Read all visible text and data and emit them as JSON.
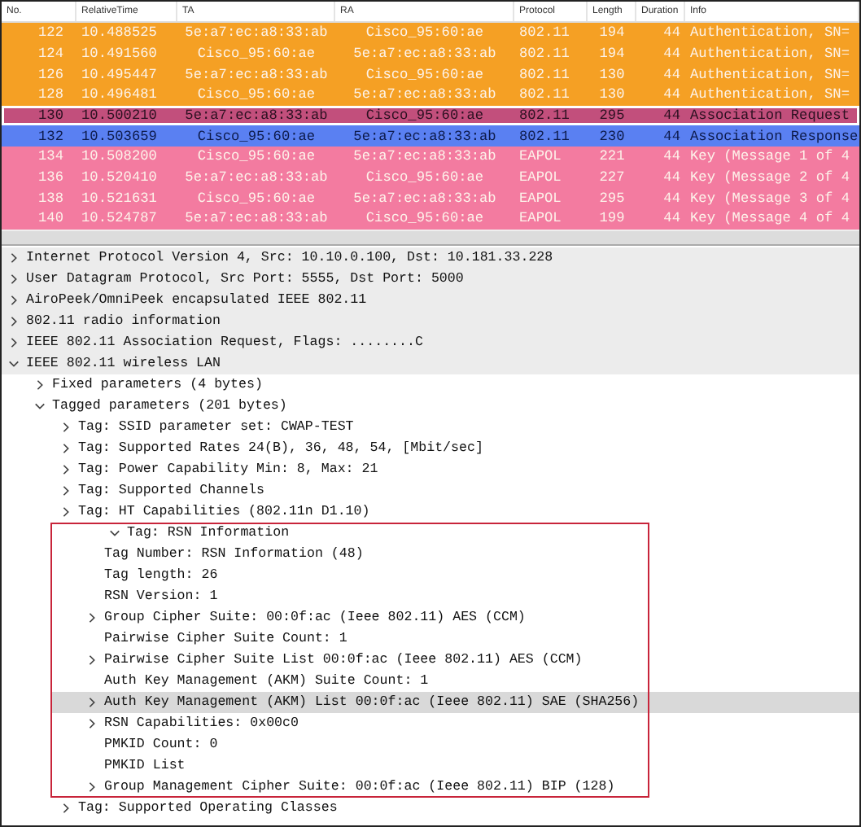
{
  "packet_list": {
    "columns": [
      "No.",
      "RelativeTime",
      "TA",
      "RA",
      "Protocol",
      "Length",
      "Duration",
      "Info"
    ],
    "rows": [
      {
        "cells": [
          "122",
          "10.488525",
          "5e:a7:ec:a8:33:ab",
          "Cisco_95:60:ae",
          "802.11",
          "194",
          "44",
          "Authentication, SN="
        ],
        "color": "#f5a024",
        "selected": false
      },
      {
        "cells": [
          "124",
          "10.491560",
          "Cisco_95:60:ae",
          "5e:a7:ec:a8:33:ab",
          "802.11",
          "194",
          "44",
          "Authentication, SN="
        ],
        "color": "#f5a024",
        "selected": false
      },
      {
        "cells": [
          "126",
          "10.495447",
          "5e:a7:ec:a8:33:ab",
          "Cisco_95:60:ae",
          "802.11",
          "130",
          "44",
          "Authentication, SN="
        ],
        "color": "#f5a024",
        "selected": false
      },
      {
        "cells": [
          "128",
          "10.496481",
          "Cisco_95:60:ae",
          "5e:a7:ec:a8:33:ab",
          "802.11",
          "130",
          "44",
          "Authentication, SN="
        ],
        "color": "#f5a024",
        "selected": false
      },
      {
        "cells": [
          "130",
          "10.500210",
          "5e:a7:ec:a8:33:ab",
          "Cisco_95:60:ae",
          "802.11",
          "295",
          "44",
          "Association Request"
        ],
        "color": "#c24f7c",
        "selected": true
      },
      {
        "cells": [
          "132",
          "10.503659",
          "Cisco_95:60:ae",
          "5e:a7:ec:a8:33:ab",
          "802.11",
          "230",
          "44",
          "Association Response"
        ],
        "color": "#5a80f2",
        "selected": false
      },
      {
        "cells": [
          "134",
          "10.508200",
          "Cisco_95:60:ae",
          "5e:a7:ec:a8:33:ab",
          "EAPOL",
          "221",
          "44",
          "Key (Message 1 of 4"
        ],
        "color": "#f37ba0",
        "selected": false
      },
      {
        "cells": [
          "136",
          "10.520410",
          "5e:a7:ec:a8:33:ab",
          "Cisco_95:60:ae",
          "EAPOL",
          "227",
          "44",
          "Key (Message 2 of 4"
        ],
        "color": "#f37ba0",
        "selected": false
      },
      {
        "cells": [
          "138",
          "10.521631",
          "Cisco_95:60:ae",
          "5e:a7:ec:a8:33:ab",
          "EAPOL",
          "295",
          "44",
          "Key (Message 3 of 4"
        ],
        "color": "#f37ba0",
        "selected": false
      },
      {
        "cells": [
          "140",
          "10.524787",
          "5e:a7:ec:a8:33:ab",
          "Cisco_95:60:ae",
          "EAPOL",
          "199",
          "44",
          "Key (Message 4 of 4"
        ],
        "color": "#f37ba0",
        "selected": false
      }
    ]
  },
  "details": [
    {
      "text": "Internet Protocol Version 4, Src: 10.10.0.100, Dst: 10.181.33.228",
      "expanded": false,
      "selected": false
    },
    {
      "text": "User Datagram Protocol, Src Port: 5555, Dst Port: 5000",
      "expanded": false,
      "selected": false
    },
    {
      "text": "AiroPeek/OmniPeek encapsulated IEEE 802.11",
      "expanded": false,
      "selected": false
    },
    {
      "text": "802.11 radio information",
      "expanded": false,
      "selected": false
    },
    {
      "text": "IEEE 802.11 Association Request, Flags: ........C",
      "expanded": false,
      "selected": false
    },
    {
      "text": "IEEE 802.11 wireless LAN",
      "expanded": true,
      "selected": false,
      "children": [
        {
          "text": "Fixed parameters (4 bytes)",
          "expanded": false,
          "selected": false
        },
        {
          "text": "Tagged parameters (201 bytes)",
          "expanded": true,
          "selected": false,
          "children": [
            {
              "text": "Tag: SSID parameter set: CWAP-TEST",
              "expanded": false,
              "selected": false,
              "outlined": false
            },
            {
              "text": "Tag: Supported Rates 24(B), 36, 48, 54, [Mbit/sec]",
              "expanded": false,
              "selected": false,
              "outlined": false
            },
            {
              "text": "Tag: Power Capability Min: 8, Max: 21",
              "expanded": false,
              "selected": false,
              "outlined": false
            },
            {
              "text": "Tag: Supported Channels",
              "expanded": false,
              "selected": false,
              "outlined": false
            },
            {
              "text": "Tag: HT Capabilities (802.11n D1.10)",
              "expanded": false,
              "selected": false,
              "outlined": false
            },
            {
              "text": "Tag: RSN Information",
              "expanded": true,
              "selected": false,
              "outlined": true,
              "children": [
                {
                  "text": "Tag Number: RSN Information (48)",
                  "selected": false
                },
                {
                  "text": "Tag length: 26",
                  "selected": false
                },
                {
                  "text": "RSN Version: 1",
                  "selected": false
                },
                {
                  "text": "Group Cipher Suite: 00:0f:ac (Ieee 802.11) AES (CCM)",
                  "expanded": false,
                  "selected": false
                },
                {
                  "text": "Pairwise Cipher Suite Count: 1",
                  "selected": false
                },
                {
                  "text": "Pairwise Cipher Suite List 00:0f:ac (Ieee 802.11) AES (CCM)",
                  "expanded": false,
                  "selected": false
                },
                {
                  "text": "Auth Key Management (AKM) Suite Count: 1",
                  "selected": false
                },
                {
                  "text": "Auth Key Management (AKM) List 00:0f:ac (Ieee 802.11) SAE (SHA256)",
                  "expanded": false,
                  "selected": true
                },
                {
                  "text": "RSN Capabilities: 0x00c0",
                  "expanded": false,
                  "selected": false
                },
                {
                  "text": "PMKID Count: 0",
                  "selected": false
                },
                {
                  "text": "PMKID List",
                  "selected": false
                },
                {
                  "text": "Group Management Cipher Suite: 00:0f:ac (Ieee 802.11) BIP (128)",
                  "expanded": false,
                  "selected": false
                }
              ]
            },
            {
              "text": "Tag: Supported Operating Classes",
              "expanded": false,
              "selected": false,
              "outlined": false
            }
          ]
        }
      ]
    }
  ]
}
